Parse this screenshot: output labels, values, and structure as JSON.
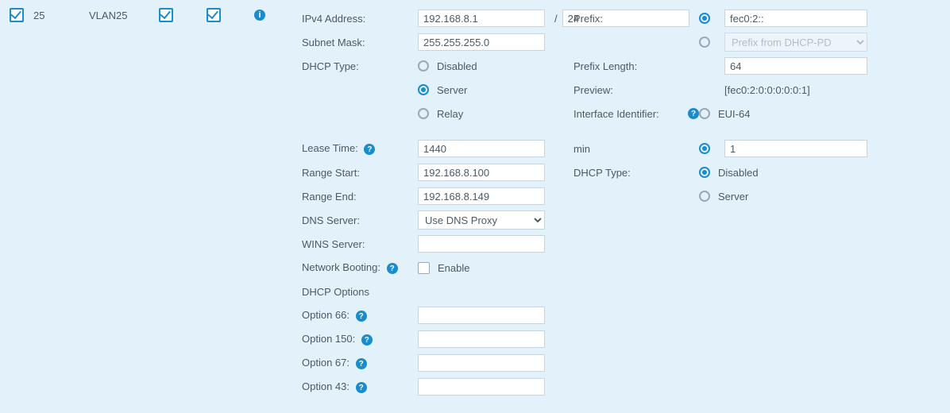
{
  "vlan": {
    "id": "25",
    "name": "VLAN25"
  },
  "ipv4": {
    "address_label": "IPv4 Address:",
    "address": "192.168.8.1",
    "cidr": "24",
    "mask_label": "Subnet Mask:",
    "mask": "255.255.255.0",
    "dhcp_type_label": "DHCP Type:",
    "opt_disabled": "Disabled",
    "opt_server": "Server",
    "opt_relay": "Relay",
    "lease_label": "Lease Time:",
    "lease": "1440",
    "lease_unit": "min",
    "rstart_label": "Range Start:",
    "rstart": "192.168.8.100",
    "rend_label": "Range End:",
    "rend": "192.168.8.149",
    "dns_label": "DNS Server:",
    "dns_value": "Use DNS Proxy",
    "wins_label": "WINS Server:",
    "wins": "",
    "netboot_label": "Network Booting:",
    "netboot_enable": "Enable",
    "dhcp_opts_label": "DHCP Options",
    "o66_label": "Option 66:",
    "o66": "",
    "o150_label": "Option 150:",
    "o150": "",
    "o67_label": "Option 67:",
    "o67": "",
    "o43_label": "Option 43:",
    "o43": ""
  },
  "ipv6": {
    "prefix_label": "Prefix:",
    "prefix": "fec0:2::",
    "prefix_pd": "Prefix from DHCP-PD",
    "plen_label": "Prefix Length:",
    "plen": "64",
    "preview_label": "Preview:",
    "preview": "[fec0:2:0:0:0:0:0:1]",
    "ifid_label": "Interface Identifier:",
    "eui": "EUI-64",
    "ifid_val": "1",
    "dhcp_label": "DHCP Type:",
    "disabled": "Disabled",
    "server": "Server"
  },
  "help": "?",
  "info": "i",
  "slash": "/"
}
